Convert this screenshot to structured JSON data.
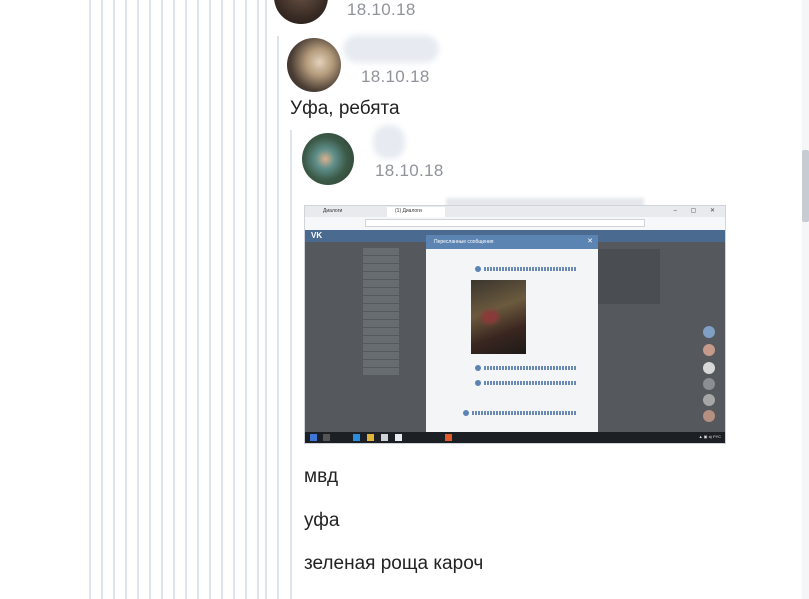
{
  "comments": [
    {
      "date": "18.10.18"
    },
    {
      "date": "18.10.18",
      "text": "Уфа, ребята"
    },
    {
      "date": "18.10.18"
    }
  ],
  "attachment": {
    "tabs": [
      "Диалоги",
      "(1) Диалоги"
    ],
    "modal_title": "Пересланные сообщения"
  },
  "messages": [
    "мвд",
    "уфа",
    "зеленая роща кароч"
  ],
  "colors": {
    "thread_line": "#dde4ee",
    "date": "#909399",
    "text": "#222222",
    "vk_blue": "#5b84b3"
  }
}
